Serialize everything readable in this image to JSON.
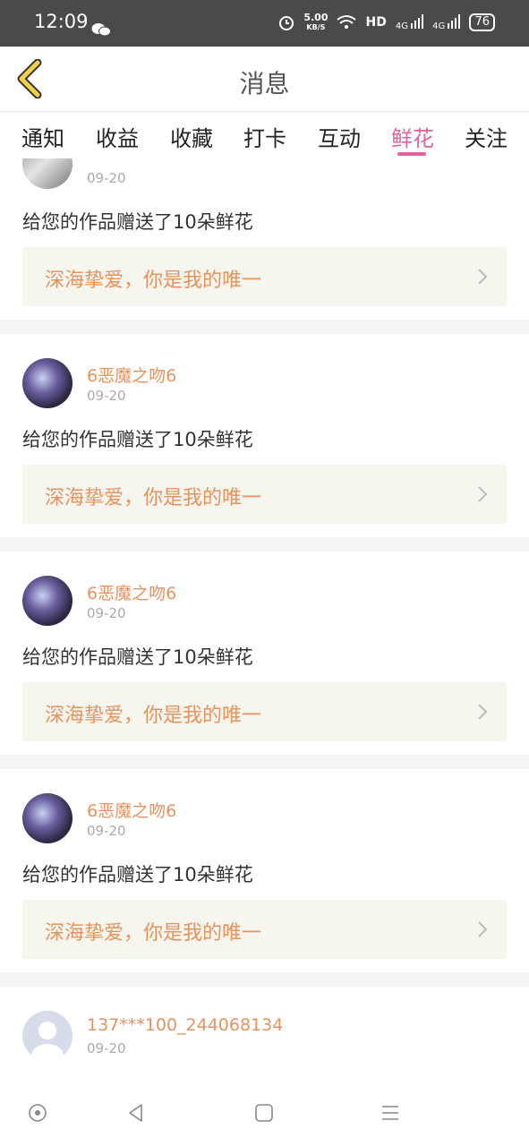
{
  "status_bar": {
    "time": "12:09",
    "speed_value": "5.00",
    "speed_unit": "KB/S",
    "hd": "HD",
    "net1": "4G",
    "net2": "4G",
    "battery": "76"
  },
  "header": {
    "title": "消息"
  },
  "tabs": [
    {
      "label": "通知",
      "active": false
    },
    {
      "label": "收益",
      "active": false
    },
    {
      "label": "收藏",
      "active": false
    },
    {
      "label": "打卡",
      "active": false
    },
    {
      "label": "互动",
      "active": false
    },
    {
      "label": "鲜花",
      "active": true
    },
    {
      "label": "关注",
      "active": false
    }
  ],
  "feed": [
    {
      "user": "",
      "date": "09-20",
      "message": "给您的作品赠送了10朵鲜花",
      "work": "深海挚爱，你是我的唯一",
      "avatar": "gray-photo"
    },
    {
      "user": "6恶魔之吻6",
      "date": "09-20",
      "message": "给您的作品赠送了10朵鲜花",
      "work": "深海挚爱，你是我的唯一",
      "avatar": "anime"
    },
    {
      "user": "6恶魔之吻6",
      "date": "09-20",
      "message": "给您的作品赠送了10朵鲜花",
      "work": "深海挚爱，你是我的唯一",
      "avatar": "anime"
    },
    {
      "user": "6恶魔之吻6",
      "date": "09-20",
      "message": "给您的作品赠送了10朵鲜花",
      "work": "深海挚爱，你是我的唯一",
      "avatar": "anime"
    },
    {
      "user": "137***100_244068134",
      "date": "09-20",
      "message": "",
      "work": "",
      "avatar": "default"
    }
  ],
  "colors": {
    "accent": "#e062a0",
    "username": "#e8925e",
    "back_icon": "#f2d147"
  }
}
